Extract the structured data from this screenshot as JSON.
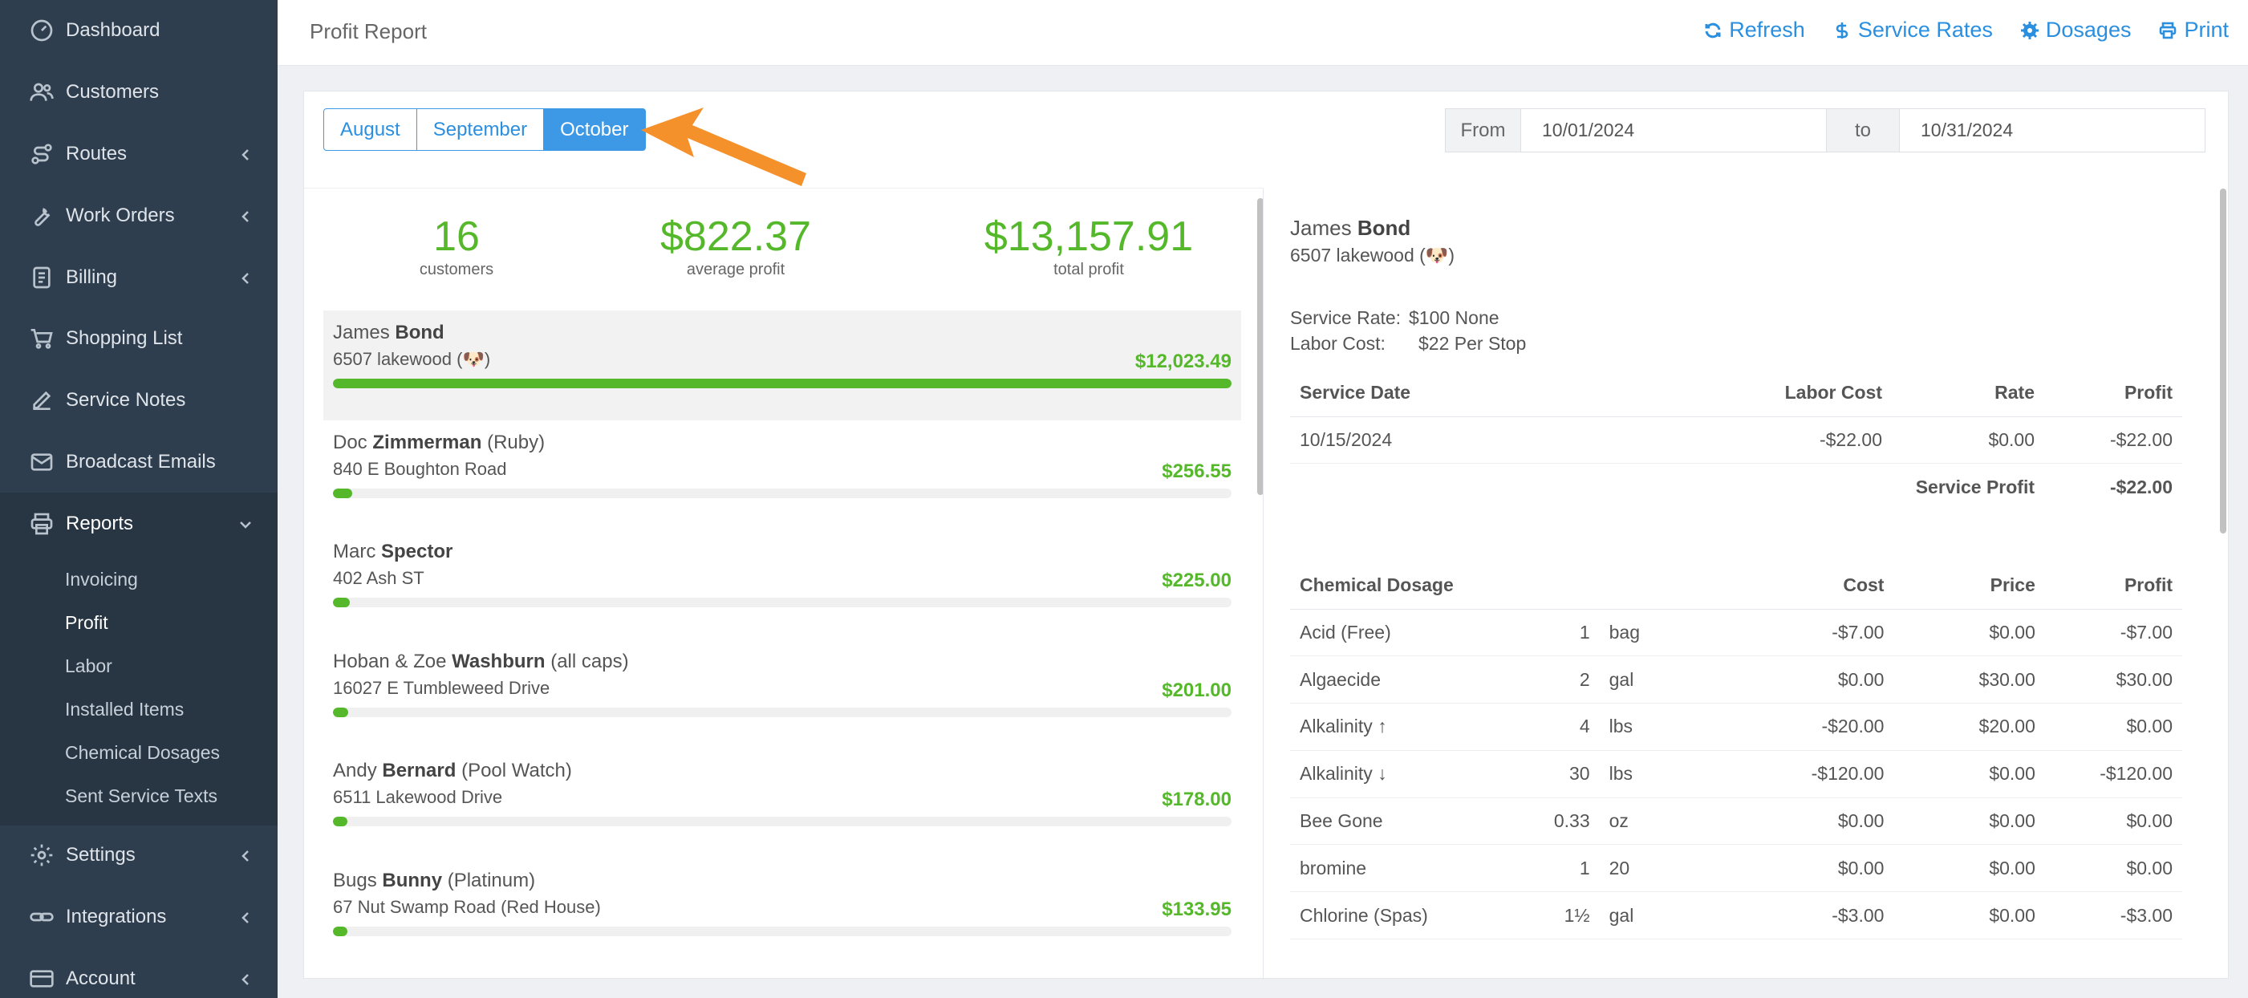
{
  "sidebar": {
    "items": [
      {
        "label": "Dashboard",
        "icon": "dashboard-icon"
      },
      {
        "label": "Customers",
        "icon": "customers-icon"
      },
      {
        "label": "Routes",
        "icon": "routes-icon"
      },
      {
        "label": "Work Orders",
        "icon": "wrench-icon"
      },
      {
        "label": "Billing",
        "icon": "billing-icon"
      },
      {
        "label": "Shopping List",
        "icon": "cart-icon"
      },
      {
        "label": "Service Notes",
        "icon": "edit-icon"
      },
      {
        "label": "Broadcast Emails",
        "icon": "envelope-icon"
      },
      {
        "label": "Reports",
        "icon": "printer-icon"
      }
    ],
    "reports_sub": [
      "Invoicing",
      "Profit",
      "Labor",
      "Installed Items",
      "Chemical Dosages",
      "Sent Service Texts"
    ],
    "bottom_items": [
      {
        "label": "Settings",
        "icon": "gear-icon"
      },
      {
        "label": "Integrations",
        "icon": "link-icon"
      },
      {
        "label": "Account",
        "icon": "card-icon"
      }
    ]
  },
  "header": {
    "title": "Profit Report",
    "actions": {
      "refresh": "Refresh",
      "service_rates": "Service Rates",
      "dosages": "Dosages",
      "print": "Print"
    }
  },
  "filters": {
    "months": [
      "August",
      "September",
      "October"
    ],
    "active_month": "October",
    "from_label": "From",
    "from_value": "10/01/2024",
    "to_label": "to",
    "to_value": "10/31/2024"
  },
  "stats": {
    "customers": {
      "value": "16",
      "label": "customers"
    },
    "average": {
      "value": "$822.37",
      "label": "average profit"
    },
    "total": {
      "value": "$13,157.91",
      "label": "total profit"
    }
  },
  "customers": [
    {
      "first": "James",
      "last": "Bond",
      "note": "",
      "address": "6507 lakewood (🐶)",
      "amount": "$12,023.49",
      "fraction": 1.0
    },
    {
      "first": "Doc",
      "last": "Zimmerman",
      "note": "(Ruby)",
      "address": "840 E Boughton Road",
      "amount": "$256.55",
      "fraction": 0.021
    },
    {
      "first": "Marc",
      "last": "Spector",
      "note": "",
      "address": "402 Ash ST",
      "amount": "$225.00",
      "fraction": 0.0187
    },
    {
      "first": "Hoban & Zoe",
      "last": "Washburn",
      "note": "(all caps)",
      "address": "16027 E Tumbleweed Drive",
      "amount": "$201.00",
      "fraction": 0.0167
    },
    {
      "first": "Andy",
      "last": "Bernard",
      "note": "(Pool Watch)",
      "address": "6511 Lakewood Drive",
      "amount": "$178.00",
      "fraction": 0.0148
    },
    {
      "first": "Bugs",
      "last": "Bunny",
      "note": "(Platinum)",
      "address": "67 Nut Swamp Road (Red House)",
      "amount": "$133.95",
      "fraction": 0.0111
    }
  ],
  "detail": {
    "first": "James",
    "last": "Bond",
    "address": "6507 lakewood (🐶)",
    "service_rate_label": "Service Rate:",
    "service_rate_value": "$100 None",
    "labor_cost_label": "Labor Cost:",
    "labor_cost_value": "$22 Per Stop",
    "service_table": {
      "headers": [
        "Service Date",
        "Labor Cost",
        "Rate",
        "Profit"
      ],
      "rows": [
        [
          "10/15/2024",
          "-$22.00",
          "$0.00",
          "-$22.00"
        ]
      ],
      "total_label": "Service Profit",
      "total_value": "-$22.00"
    },
    "dosage_table": {
      "headers": [
        "Chemical Dosage",
        "",
        "",
        "Cost",
        "Price",
        "Profit"
      ],
      "rows": [
        [
          "Acid (Free)",
          "1",
          "bag",
          "-$7.00",
          "$0.00",
          "-$7.00"
        ],
        [
          "Algaecide",
          "2",
          "gal",
          "$0.00",
          "$30.00",
          "$30.00"
        ],
        [
          "Alkalinity ↑",
          "4",
          "lbs",
          "-$20.00",
          "$20.00",
          "$0.00"
        ],
        [
          "Alkalinity ↓",
          "30",
          "lbs",
          "-$120.00",
          "$0.00",
          "-$120.00"
        ],
        [
          "Bee Gone",
          "0.33",
          "oz",
          "$0.00",
          "$0.00",
          "$0.00"
        ],
        [
          "bromine",
          "1",
          "20",
          "$0.00",
          "$0.00",
          "$0.00"
        ],
        [
          "Chlorine (Spas)",
          "1½",
          "gal",
          "-$3.00",
          "$0.00",
          "-$3.00"
        ]
      ]
    }
  },
  "colors": {
    "accent": "#3d99e6",
    "positive": "#55b82a",
    "negative": "#d9302c",
    "sidebar": "#2f3e4e",
    "arrow": "#f5912a"
  }
}
